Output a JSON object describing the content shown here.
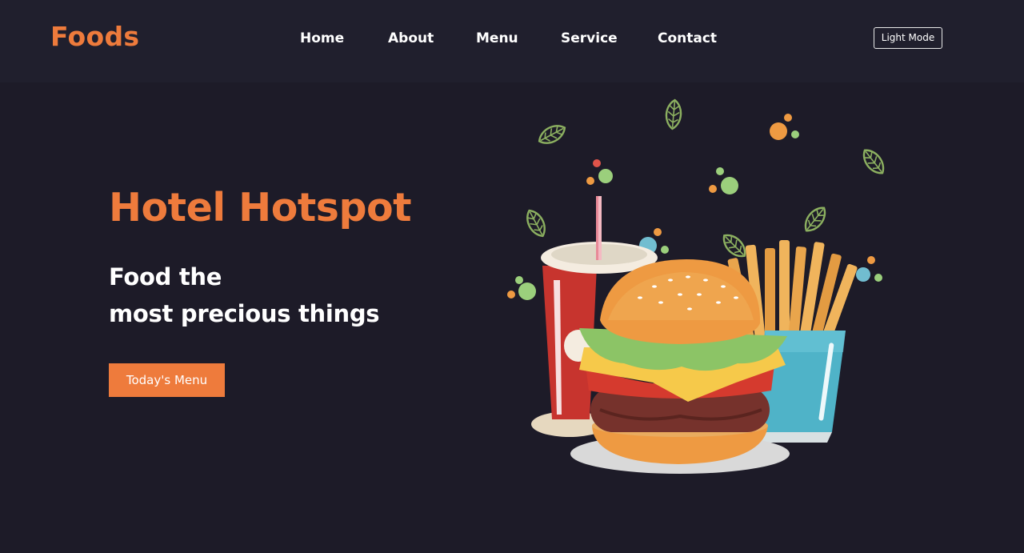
{
  "header": {
    "logo": "Foods",
    "nav": [
      "Home",
      "About",
      "Menu",
      "Service",
      "Contact"
    ],
    "mode_toggle": "Light Mode"
  },
  "hero": {
    "title": "Hotel Hotspot",
    "subtitle_line1": "Food the",
    "subtitle_line2": "most precious things",
    "cta": "Today's Menu"
  },
  "colors": {
    "background": "#1d1b28",
    "header_background": "#201f2d",
    "accent": "#ee7b3c",
    "text": "#ffffff"
  },
  "illustration": {
    "subject": "burger-drink-fries-illustration"
  }
}
